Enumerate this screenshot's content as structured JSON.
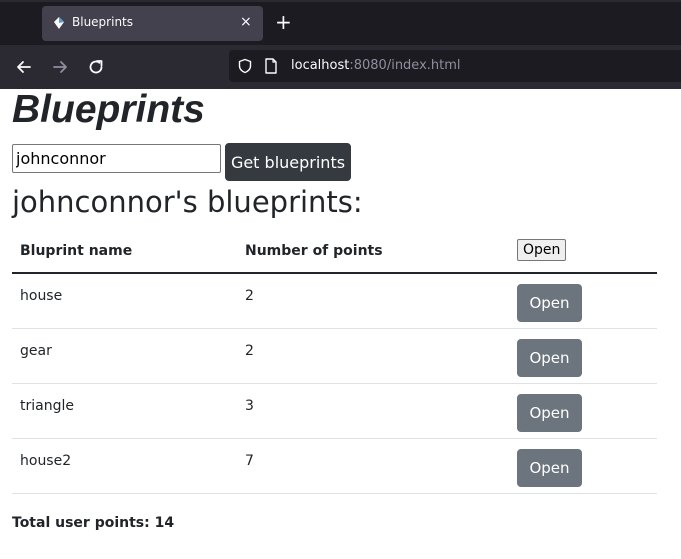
{
  "browser": {
    "tab_title": "Blueprints",
    "close_glyph": "×",
    "newtab_glyph": "+",
    "url_host": "localhost",
    "url_rest": ":8080/index.html"
  },
  "page": {
    "title": "Blueprints",
    "author_value": "johnconnor",
    "get_button": "Get blueprints",
    "subtitle": "johnconnor's blueprints:",
    "table": {
      "headers": [
        "Bluprint name",
        "Number of points"
      ],
      "header_button": "Open",
      "rows": [
        {
          "name": "house",
          "points": "2",
          "button": "Open"
        },
        {
          "name": "gear",
          "points": "2",
          "button": "Open"
        },
        {
          "name": "triangle",
          "points": "3",
          "button": "Open"
        },
        {
          "name": "house2",
          "points": "7",
          "button": "Open"
        }
      ]
    },
    "total_label": "Total user points: 14"
  },
  "colors": {
    "chrome_dark": "#1c1b22",
    "chrome_mid": "#2b2a33",
    "tab_active": "#42414d",
    "dark_button": "#343a40",
    "secondary_button": "#6c757d"
  }
}
